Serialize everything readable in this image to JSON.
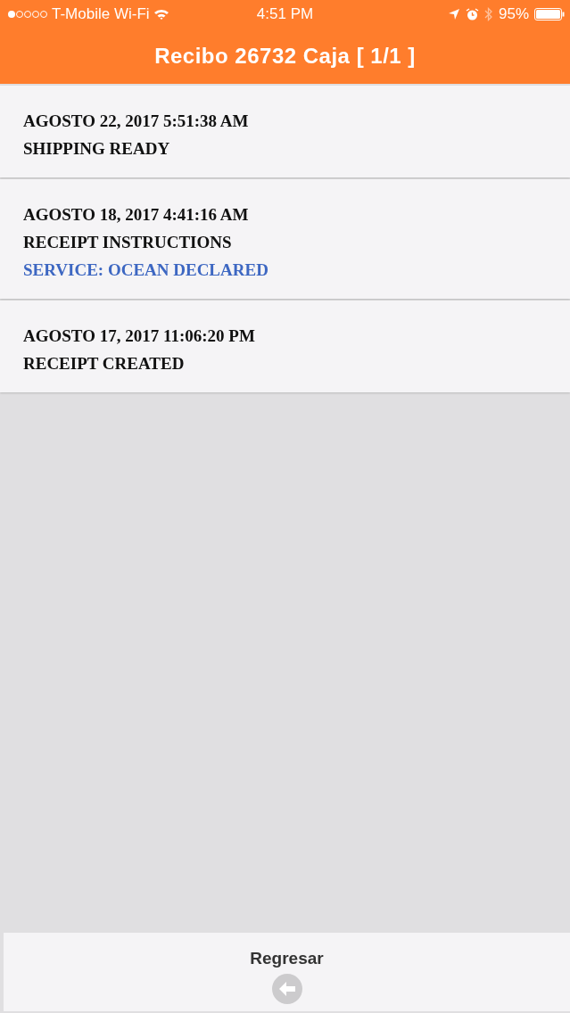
{
  "status_bar": {
    "carrier": "T-Mobile Wi-Fi",
    "time": "4:51 PM",
    "battery": "95%"
  },
  "header": {
    "title": "Recibo 26732 Caja [ 1/1 ]"
  },
  "events": [
    {
      "lines": [
        {
          "kind": "date",
          "text": "AGOSTO 22, 2017 5:51:38 AM"
        },
        {
          "kind": "status",
          "text": "SHIPPING READY"
        }
      ]
    },
    {
      "lines": [
        {
          "kind": "date",
          "text": "AGOSTO 18, 2017 4:41:16 AM"
        },
        {
          "kind": "status",
          "text": "RECEIPT INSTRUCTIONS"
        },
        {
          "kind": "service",
          "text": "SERVICE: OCEAN DECLARED"
        }
      ]
    },
    {
      "lines": [
        {
          "kind": "date",
          "text": "AGOSTO 17, 2017 11:06:20 PM"
        },
        {
          "kind": "status",
          "text": "RECEIPT CREATED"
        }
      ]
    }
  ],
  "footer": {
    "button": "Regresar"
  }
}
